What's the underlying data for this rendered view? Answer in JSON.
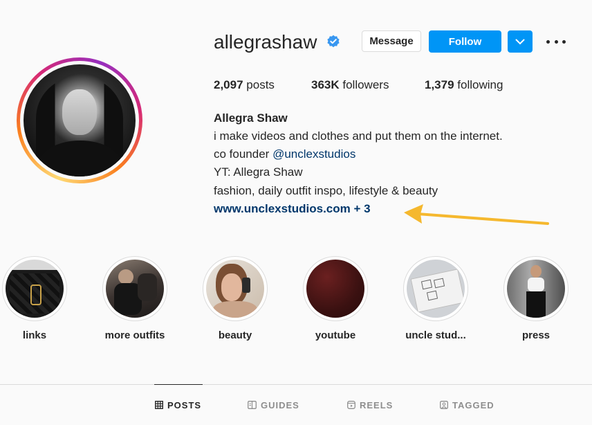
{
  "profile": {
    "username": "allegrashaw",
    "verified": true,
    "buttons": {
      "message": "Message",
      "follow": "Follow"
    },
    "stats": {
      "posts_count": "2,097",
      "posts_label": "posts",
      "followers_count": "363K",
      "followers_label": "followers",
      "following_count": "1,379",
      "following_label": "following"
    },
    "bio": {
      "name": "Allegra Shaw",
      "line1": "i make videos and clothes and put them on the internet.",
      "line2_prefix": "co founder ",
      "line2_mention": "@unclexstudios",
      "line3": "YT: Allegra Shaw",
      "line4": "fashion, daily outfit inspo, lifestyle & beauty",
      "link": "www.unclexstudios.com + 3"
    }
  },
  "highlights": [
    {
      "label": "links"
    },
    {
      "label": "more outfits"
    },
    {
      "label": "beauty"
    },
    {
      "label": "youtube"
    },
    {
      "label": "uncle stud..."
    },
    {
      "label": "press"
    }
  ],
  "tabs": [
    {
      "label": "POSTS",
      "icon": "grid-icon",
      "active": true
    },
    {
      "label": "GUIDES",
      "icon": "guides-icon",
      "active": false
    },
    {
      "label": "REELS",
      "icon": "reels-icon",
      "active": false
    },
    {
      "label": "TAGGED",
      "icon": "tagged-icon",
      "active": false
    }
  ],
  "colors": {
    "accent": "#0095f6",
    "link": "#00376b",
    "annotation_arrow": "#f5b82e"
  }
}
